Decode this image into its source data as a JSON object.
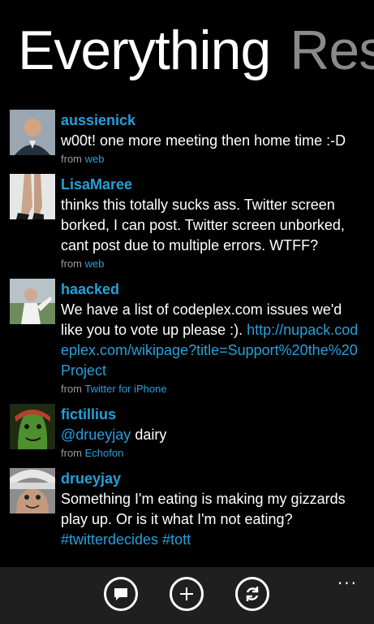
{
  "pivot": {
    "active": "Everything",
    "next": "Res"
  },
  "tweets": [
    {
      "user": "aussienick",
      "text": "w00t! one more meeting then home time :-D",
      "from_label": "from",
      "source": "web",
      "avatar": "avatar-man-suit"
    },
    {
      "user": "LisaMaree",
      "text": "thinks this totally sucks ass. Twitter screen borked, I can post. Twitter screen unborked, cant post due to multiple errors. WTFF?",
      "from_label": "from",
      "source": "web",
      "avatar": "avatar-legs-heels"
    },
    {
      "user": "haacked",
      "text_plain": "We have a list of codeplex.com issues we'd like you to vote up please :). ",
      "link": "http://nupack.codeplex.com/wikipage?title=Support%20the%20Project",
      "from_label": "from",
      "source": "Twitter for iPhone",
      "avatar": "avatar-outdoor"
    },
    {
      "user": "fictillius",
      "mention": "@drueyjay",
      "text_after": " dairy",
      "from_label": "from",
      "source": "Echofon",
      "avatar": "avatar-green-face"
    },
    {
      "user": "drueyjay",
      "text": "Something I'm eating is making my gizzards play up. Or is it what I'm not eating? ",
      "hashtags": "#twitterdecides #tott",
      "avatar": "avatar-hat-face"
    }
  ],
  "appbar": {
    "buttons": [
      "compose-icon",
      "add-icon",
      "refresh-icon"
    ],
    "more": "..."
  },
  "colors": {
    "accent": "#25a0da",
    "background": "#000000",
    "appbar": "#1f1f1f"
  }
}
